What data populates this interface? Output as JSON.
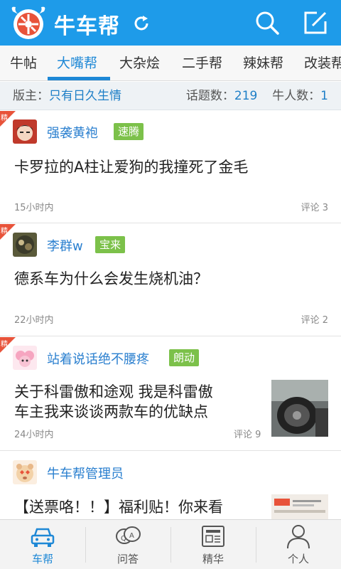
{
  "header": {
    "title": "牛车帮",
    "logo_icon": "bull-wheel-logo",
    "refresh_icon": "refresh-icon",
    "search_icon": "search-icon",
    "compose_icon": "edit-icon",
    "bg_color": "#1e9be9"
  },
  "tabs": [
    {
      "label": "牛帖"
    },
    {
      "label": "大嘴帮",
      "active": true
    },
    {
      "label": "大杂烩"
    },
    {
      "label": "二手帮"
    },
    {
      "label": "辣妹帮"
    },
    {
      "label": "改装帮"
    }
  ],
  "infobar": {
    "moderator_label": "版主：",
    "moderator_name": "只有日久生情",
    "topics_label": "话题数：",
    "topics_count": "219",
    "experts_label": "牛人数：",
    "experts_count": "1"
  },
  "posts": [
    {
      "featured": true,
      "featured_label": "精",
      "username": "强袭黄袍",
      "tag": "速腾",
      "title": "卡罗拉的A柱让爱狗的我撞死了金毛",
      "time": "15小时内",
      "comments": "评论 3"
    },
    {
      "featured": true,
      "featured_label": "精",
      "username": "李群w",
      "tag": "宝来",
      "title": "德系车为什么会发生烧机油？",
      "time": "22小时内",
      "comments": "评论 2"
    },
    {
      "featured": true,
      "featured_label": "精",
      "username": "站着说话绝不腰疼",
      "tag": "朗动",
      "title_line1": "关于科雷傲和途观 我是科雷傲",
      "title_line2": "车主我来谈谈两款车的优缺点",
      "time": "24小时内",
      "comments": "评论 9"
    },
    {
      "featured": false,
      "username": "牛车帮管理员",
      "title": "【送票咯！！】福利贴！你来看"
    }
  ],
  "bottom_nav": [
    {
      "label": "车帮",
      "icon": "car-icon",
      "active": true
    },
    {
      "label": "问答",
      "icon": "qa-icon"
    },
    {
      "label": "精华",
      "icon": "news-icon"
    },
    {
      "label": "个人",
      "icon": "person-icon"
    }
  ],
  "colors": {
    "accent": "#1e88d6",
    "tag_green": "#7cc14a",
    "featured_red": "#e8533a"
  }
}
